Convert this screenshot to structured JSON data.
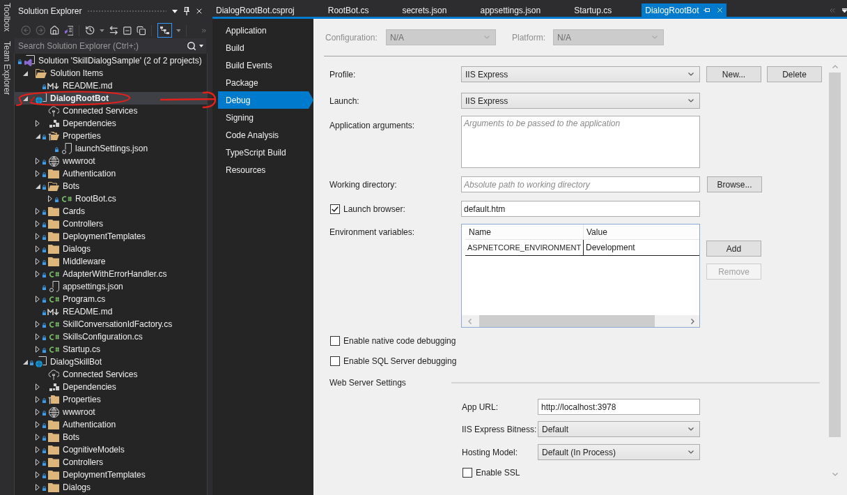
{
  "side_tabs": [
    "Toolbox",
    "Team Explorer"
  ],
  "solution_explorer": {
    "title": "Solution Explorer",
    "search": {
      "placeholder": "Search Solution Explorer (Ctrl+;)"
    },
    "tree": [
      {
        "label": "Solution 'SkillDialogSample' (2 of 2 projects)",
        "kind": "solution",
        "locked": true,
        "selected": false,
        "children": [
          {
            "label": "Solution Items",
            "kind": "folder",
            "locked": false,
            "pending_edit": false,
            "expanded": true,
            "selected": false,
            "children": [
              {
                "label": "README.md",
                "kind": "markdown",
                "locked": true,
                "selected": false
              }
            ]
          },
          {
            "label": "DialogRootBot",
            "kind": "project",
            "locked": false,
            "pending_edit": true,
            "startup": true,
            "expanded": true,
            "selected": true,
            "children": [
              {
                "label": "Connected Services",
                "kind": "connected",
                "locked": false,
                "selected": false
              },
              {
                "label": "Dependencies",
                "kind": "dependencies",
                "locked": false,
                "expanded": false,
                "selected": false
              },
              {
                "label": "Properties",
                "kind": "properties",
                "locked": true,
                "expanded": true,
                "selected": false,
                "children": [
                  {
                    "label": "launchSettings.json",
                    "kind": "json",
                    "locked": true,
                    "selected": false
                  }
                ]
              },
              {
                "label": "wwwroot",
                "kind": "globe",
                "locked": true,
                "expanded": false,
                "selected": false
              },
              {
                "label": "Authentication",
                "kind": "folder",
                "locked": true,
                "expanded": false,
                "selected": false
              },
              {
                "label": "Bots",
                "kind": "folder",
                "locked": true,
                "expanded": true,
                "selected": false,
                "children": [
                  {
                    "label": "RootBot.cs",
                    "kind": "csharp",
                    "locked": true,
                    "expanded": false,
                    "selected": false
                  }
                ]
              },
              {
                "label": "Cards",
                "kind": "folder",
                "locked": true,
                "expanded": false,
                "selected": false
              },
              {
                "label": "Controllers",
                "kind": "folder",
                "locked": true,
                "expanded": false,
                "selected": false
              },
              {
                "label": "DeploymentTemplates",
                "kind": "folder",
                "locked": true,
                "expanded": false,
                "selected": false
              },
              {
                "label": "Dialogs",
                "kind": "folder",
                "locked": true,
                "expanded": false,
                "selected": false
              },
              {
                "label": "Middleware",
                "kind": "folder",
                "locked": true,
                "expanded": false,
                "selected": false
              },
              {
                "label": "AdapterWithErrorHandler.cs",
                "kind": "csharp",
                "locked": true,
                "expanded": false,
                "selected": false
              },
              {
                "label": "appsettings.json",
                "kind": "json",
                "locked": true,
                "selected": false
              },
              {
                "label": "Program.cs",
                "kind": "csharp",
                "locked": true,
                "expanded": false,
                "selected": false
              },
              {
                "label": "README.md",
                "kind": "markdown",
                "locked": true,
                "selected": false
              },
              {
                "label": "SkillConversationIdFactory.cs",
                "kind": "csharp",
                "locked": true,
                "expanded": false,
                "selected": false
              },
              {
                "label": "SkillsConfiguration.cs",
                "kind": "csharp",
                "locked": true,
                "expanded": false,
                "selected": false
              },
              {
                "label": "Startup.cs",
                "kind": "csharp",
                "locked": true,
                "expanded": false,
                "selected": false
              }
            ]
          },
          {
            "label": "DialogSkillBot",
            "kind": "project",
            "locked": true,
            "pending_edit": false,
            "startup": false,
            "expanded": true,
            "selected": false,
            "children": [
              {
                "label": "Connected Services",
                "kind": "connected",
                "locked": false,
                "selected": false
              },
              {
                "label": "Dependencies",
                "kind": "dependencies",
                "locked": false,
                "expanded": false,
                "selected": false
              },
              {
                "label": "Properties",
                "kind": "properties",
                "locked": true,
                "expanded": false,
                "selected": false
              },
              {
                "label": "wwwroot",
                "kind": "globe",
                "locked": true,
                "expanded": false,
                "selected": false
              },
              {
                "label": "Authentication",
                "kind": "folder",
                "locked": true,
                "expanded": false,
                "selected": false
              },
              {
                "label": "Bots",
                "kind": "folder",
                "locked": true,
                "expanded": false,
                "selected": false
              },
              {
                "label": "CognitiveModels",
                "kind": "folder",
                "locked": true,
                "expanded": false,
                "selected": false
              },
              {
                "label": "Controllers",
                "kind": "folder",
                "locked": true,
                "expanded": false,
                "selected": false
              },
              {
                "label": "DeploymentTemplates",
                "kind": "folder",
                "locked": true,
                "expanded": false,
                "selected": false
              },
              {
                "label": "Dialogs",
                "kind": "folder",
                "locked": true,
                "expanded": false,
                "selected": false
              }
            ]
          }
        ]
      }
    ]
  },
  "editor_tabs": [
    {
      "label": "DialogRootBot.csproj",
      "selected": false
    },
    {
      "label": "RootBot.cs",
      "selected": false
    },
    {
      "label": "secrets.json",
      "selected": false
    },
    {
      "label": "appsettings.json",
      "selected": false
    },
    {
      "label": "Startup.cs",
      "selected": false
    },
    {
      "label": "DialogRootBot",
      "selected": true
    }
  ],
  "property_nav": [
    {
      "label": "Application",
      "selected": false
    },
    {
      "label": "Build",
      "selected": false
    },
    {
      "label": "Build Events",
      "selected": false
    },
    {
      "label": "Package",
      "selected": false
    },
    {
      "label": "Debug",
      "selected": true
    },
    {
      "label": "Signing",
      "selected": false
    },
    {
      "label": "Code Analysis",
      "selected": false
    },
    {
      "label": "TypeScript Build",
      "selected": false
    },
    {
      "label": "Resources",
      "selected": false
    }
  ],
  "config_bar": {
    "configuration": {
      "label": "Configuration:",
      "value": "N/A",
      "disabled": true
    },
    "platform": {
      "label": "Platform:",
      "value": "N/A",
      "disabled": true
    }
  },
  "debug": {
    "profile": {
      "label": "Profile:",
      "value": "IIS Express",
      "buttons": [
        "New...",
        "Delete"
      ]
    },
    "launch": {
      "label": "Launch:",
      "value": "IIS Express"
    },
    "app_arguments": {
      "label": "Application arguments:",
      "placeholder": "Arguments to be passed to the application"
    },
    "working_directory": {
      "label": "Working directory:",
      "placeholder": "Absolute path to working directory",
      "button": "Browse..."
    },
    "launch_browser": {
      "label": "Launch browser:",
      "checked": true,
      "value": "default.htm"
    },
    "environment": {
      "label": "Environment variables:",
      "columns": [
        "Name",
        "Value"
      ],
      "rows": [
        [
          "ASPNETCORE_ENVIRONMENT",
          "Development"
        ]
      ],
      "buttons": [
        {
          "label": "Add",
          "disabled": false
        },
        {
          "label": "Remove",
          "disabled": true
        }
      ]
    },
    "options": [
      {
        "label": "Enable native code debugging",
        "checked": false
      },
      {
        "label": "Enable SQL Server debugging",
        "checked": false
      }
    ],
    "web_server": {
      "title": "Web Server Settings",
      "app_url": {
        "label": "App URL:",
        "value": "http://localhost:3978"
      },
      "bitness": {
        "label": "IIS Express Bitness:",
        "value": "Default"
      },
      "hosting_model": {
        "label": "Hosting Model:",
        "value": "Default (In Process)"
      },
      "ssl": {
        "label": "Enable SSL",
        "checked": false
      }
    }
  }
}
